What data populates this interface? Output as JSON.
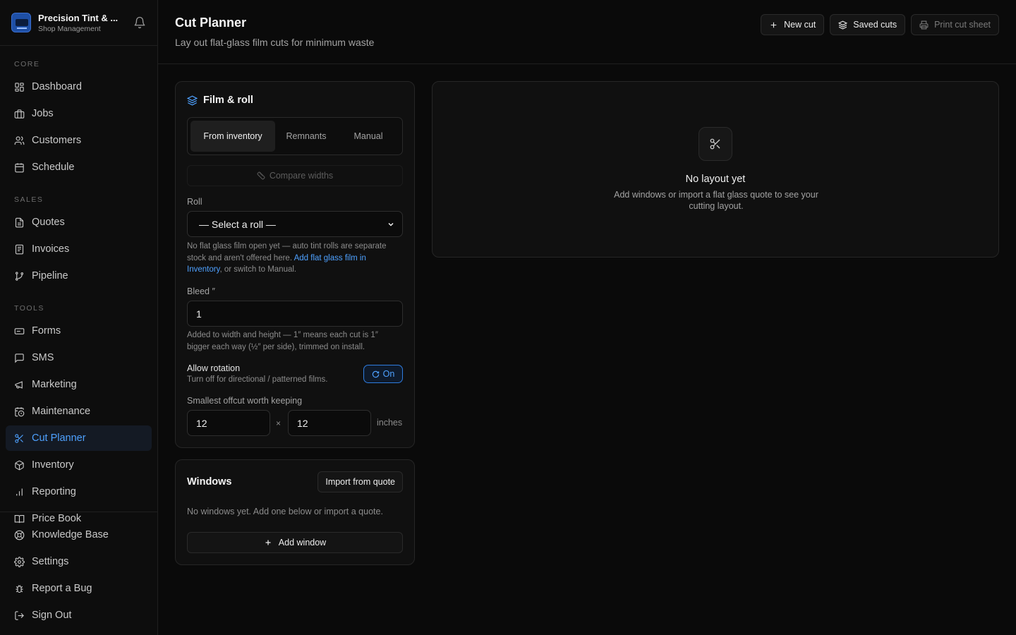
{
  "brand": {
    "name": "Precision Tint & ...",
    "subtitle": "Shop Management"
  },
  "nav": {
    "core_label": "CORE",
    "core": [
      {
        "label": "Dashboard",
        "icon": "dashboard-icon"
      },
      {
        "label": "Jobs",
        "icon": "briefcase-icon"
      },
      {
        "label": "Customers",
        "icon": "users-icon"
      },
      {
        "label": "Schedule",
        "icon": "calendar-icon"
      }
    ],
    "sales_label": "SALES",
    "sales": [
      {
        "label": "Quotes",
        "icon": "document-icon"
      },
      {
        "label": "Invoices",
        "icon": "receipt-icon"
      },
      {
        "label": "Pipeline",
        "icon": "git-branch-icon"
      }
    ],
    "tools_label": "TOOLS",
    "tools": [
      {
        "label": "Forms",
        "icon": "form-icon"
      },
      {
        "label": "SMS",
        "icon": "message-icon"
      },
      {
        "label": "Marketing",
        "icon": "megaphone-icon"
      },
      {
        "label": "Maintenance",
        "icon": "calendar-clock-icon"
      },
      {
        "label": "Cut Planner",
        "icon": "scissors-icon"
      },
      {
        "label": "Inventory",
        "icon": "box-icon"
      },
      {
        "label": "Reporting",
        "icon": "bar-chart-icon"
      },
      {
        "label": "Price Book",
        "icon": "book-icon"
      }
    ],
    "bottom": [
      {
        "label": "Knowledge Base",
        "icon": "lifebuoy-icon"
      },
      {
        "label": "Settings",
        "icon": "gear-icon"
      },
      {
        "label": "Report a Bug",
        "icon": "bug-icon"
      },
      {
        "label": "Sign Out",
        "icon": "logout-icon"
      }
    ],
    "active": "Cut Planner"
  },
  "header": {
    "title": "Cut Planner",
    "subtitle": "Lay out flat-glass film cuts for minimum waste",
    "new_cut": "New cut",
    "saved_cuts": "Saved cuts",
    "print_cut_sheet": "Print cut sheet"
  },
  "film": {
    "title": "Film & roll",
    "segments": [
      "From inventory",
      "Remnants",
      "Manual"
    ],
    "active_segment": "From inventory",
    "compare_widths": "Compare widths",
    "roll_label": "Roll",
    "roll_value": "— Select a roll —",
    "roll_help_prefix": "No flat glass film open yet — auto tint rolls are separate stock and aren't offered here.",
    "roll_help_link": "Add flat glass film in Inventory",
    "roll_help_suffix": ", or switch to Manual.",
    "bleed_label": "Bleed ″",
    "bleed_value": "1",
    "bleed_help": "Added to width and height — 1″ means each cut is 1″ bigger each way (½″ per side), trimmed on install.",
    "rotation_title": "Allow rotation",
    "rotation_sub": "Turn off for directional / patterned films.",
    "rotation_state": "On",
    "offcut_label": "Smallest offcut worth keeping",
    "offcut_width": "12",
    "offcut_height": "12",
    "offcut_times": "×",
    "offcut_unit": "inches"
  },
  "windows": {
    "title": "Windows",
    "import_label": "Import from quote",
    "empty_text": "No windows yet. Add one below or import a quote.",
    "add_label": "Add window"
  },
  "layout": {
    "empty_title": "No layout yet",
    "empty_sub": "Add windows or import a flat glass quote to see your cutting layout."
  },
  "colors": {
    "accent": "#4ea1ff",
    "background": "#0a0a0a",
    "card": "#101010"
  }
}
